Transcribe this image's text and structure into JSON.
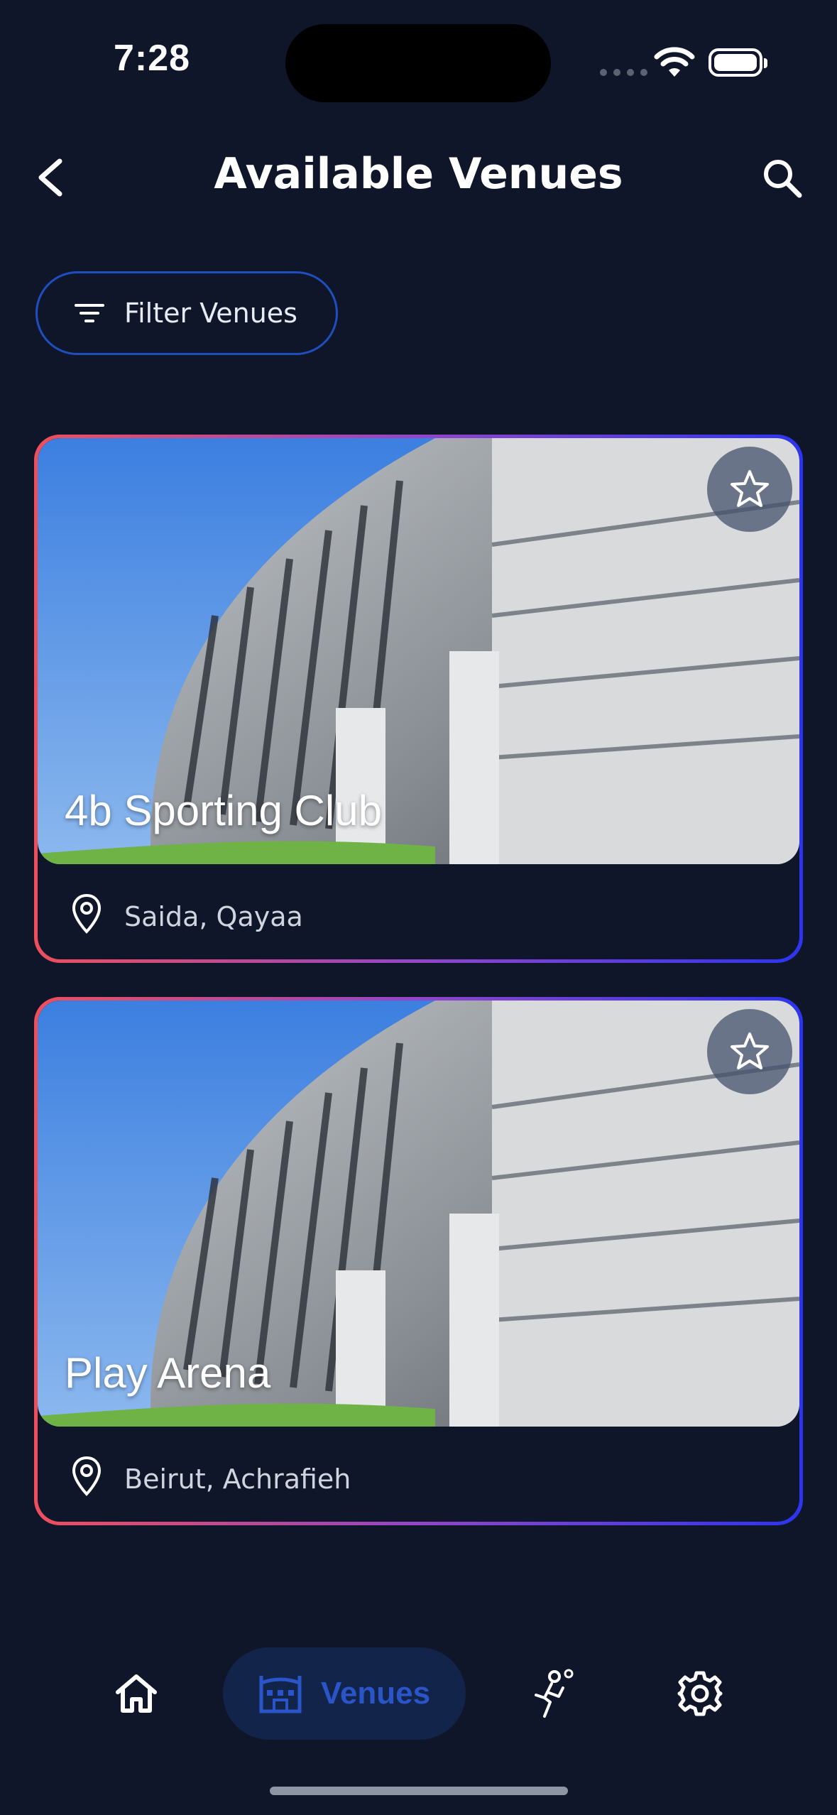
{
  "status_bar": {
    "time": "7:28"
  },
  "header": {
    "title": "Available Venues"
  },
  "filter": {
    "label": "Filter Venues"
  },
  "venues": [
    {
      "name": "4b Sporting Club",
      "location": "Saida, Qayaa"
    },
    {
      "name": "Play Arena",
      "location": "Beirut, Achrafieh"
    }
  ],
  "nav": {
    "items": [
      {
        "icon": "home-icon"
      },
      {
        "icon": "stadium-icon",
        "label": "Venues",
        "active": true
      },
      {
        "icon": "player-icon"
      },
      {
        "icon": "gear-icon"
      }
    ]
  },
  "colors": {
    "background": "#0f1629",
    "accent": "#2a55c8",
    "card_gradient_start": "#ef4f5a",
    "card_gradient_end": "#2d34f0"
  }
}
